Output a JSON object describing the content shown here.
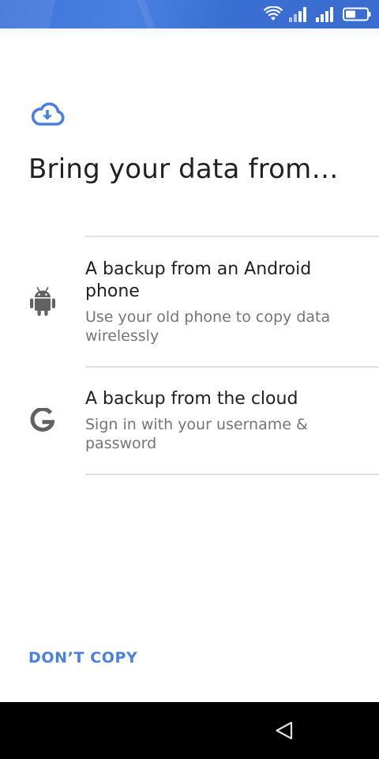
{
  "status_bar": {
    "wifi_icon": "wifi-icon",
    "signal_icons": [
      "signal-sim1-icon",
      "signal-sim2-icon"
    ],
    "battery_icon": "battery-icon"
  },
  "header": {
    "icon": "cloud-download-icon",
    "title": "Bring your data from…"
  },
  "options": [
    {
      "icon": "android-icon",
      "title": "A backup from an Android phone",
      "subtitle": "Use your old phone to copy data wirelessly"
    },
    {
      "icon": "google-icon",
      "title": "A backup from the cloud",
      "subtitle": "Sign in with your username & password"
    }
  ],
  "footer": {
    "dont_copy_label": "DON’T COPY"
  },
  "nav_bar": {
    "back_icon": "back-triangle-icon"
  },
  "colors": {
    "accent": "#4a80e2",
    "status_bar": "#3f74d8",
    "title_text": "#212121",
    "secondary_text": "#757575",
    "divider": "#e0e0e0",
    "nav_bar": "#000000"
  }
}
